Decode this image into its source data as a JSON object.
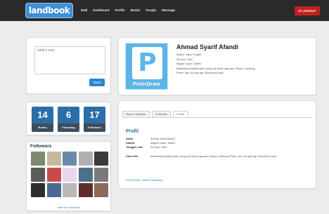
{
  "header": {
    "logo": "landbook",
    "nav": [
      "Wall",
      "Dashboard",
      "Profile",
      "Books",
      "People",
      "Message"
    ],
    "logout": "LOGOUT"
  },
  "status_box": {
    "placeholder": "what's new",
    "share": "share"
  },
  "stats": [
    {
      "value": "14",
      "label": "Books"
    },
    {
      "value": "6",
      "label": "Following"
    },
    {
      "value": "17",
      "label": "Followers"
    }
  ],
  "followers": {
    "title": "Followers",
    "view_all": "View All Followers",
    "photo_colors": [
      "#7d8a6f",
      "#c9b8a0",
      "#6b8aa8",
      "#b0b0b0",
      "#3a3a3a",
      "#5a5a5a",
      "#c74d4d",
      "#e9d5f0",
      "#4d6f8a",
      "#7a7a7a",
      "#2d2d2d",
      "#4a6a8f",
      "#b8b8b8",
      "#5e2e2e",
      "#8a6a5a"
    ]
  },
  "profile": {
    "name": "Ahmad Syarif Afandi",
    "logo_letter": "P",
    "logo_text": "PeterDraw",
    "info": [
      "Klaten, Jawa Tengah",
      "30 June 1994",
      "Magas Capar, Klaten",
      "Mahasiswa tingkat akhir yang sok sibuk ngurusin Skripsi, Ganteng",
      "Pinter, dan Ga ada lagi. Benahuhe kayo"
    ]
  },
  "tabs": {
    "items": [
      "Recent Updates",
      "Collection",
      "Profile"
    ],
    "active": 2
  },
  "profile_section": {
    "heading": "Profil",
    "rows": [
      {
        "key": "Nama",
        "value": "Ahmad Syarif Afandi"
      },
      {
        "key": "Alamat",
        "value": "Magas Capar, Klaten"
      },
      {
        "key": "Tanggal Lahir",
        "value": "30 June 1994"
      },
      {
        "key": "About Me",
        "value": "Mahasiswa tingkat akhir yang sok sibuk ngurusin Skripsi, Ganteng Pinter, dan Ga ada lagi. Benahuhe kayo"
      }
    ],
    "links": "[ Edit Profile | Reset Password ]"
  }
}
